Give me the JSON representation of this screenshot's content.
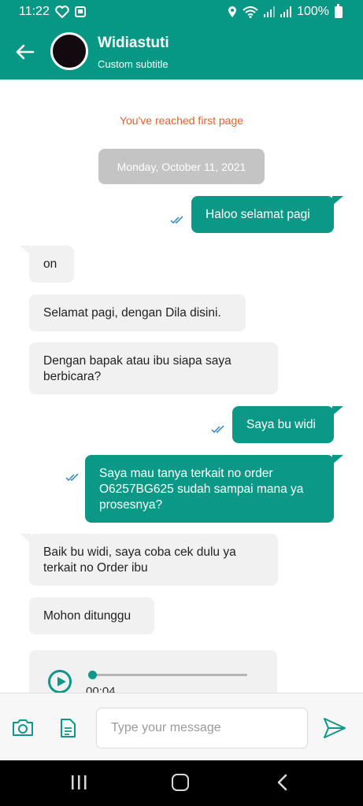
{
  "status_bar": {
    "time": "11:22",
    "battery": "100%"
  },
  "header": {
    "title": "Widiastuti",
    "subtitle": "Custom subtitle"
  },
  "chat": {
    "notice": "You've reached first page",
    "date": "Monday, October 11, 2021",
    "messages": [
      {
        "direction": "out",
        "text": "Haloo selamat pagi"
      },
      {
        "direction": "in",
        "text": "on"
      },
      {
        "direction": "in",
        "text": "Selamat pagi, dengan Dila disini."
      },
      {
        "direction": "in",
        "text": "Dengan bapak atau ibu siapa saya berbicara?"
      },
      {
        "direction": "out",
        "text": "Saya bu widi"
      },
      {
        "direction": "out",
        "text": "Saya mau tanya terkait no order O6257BG625 sudah sampai mana ya prosesnya?"
      },
      {
        "direction": "in",
        "text": "Baik bu widi, saya coba cek dulu ya terkait no Order ibu"
      },
      {
        "direction": "in",
        "text": "Mohon ditunggu"
      }
    ],
    "audio": {
      "duration": "00:04",
      "progress": 0.0
    }
  },
  "composer": {
    "placeholder": "Type your message"
  },
  "icons": {
    "back": "arrow-left-icon",
    "camera": "camera-icon",
    "attachment": "document-icon",
    "send": "send-icon",
    "read_receipt": "double-check-icon",
    "play": "play-icon"
  },
  "colors": {
    "brand": "#079885",
    "outgoing_bubble": "#0b9886",
    "incoming_bubble": "#f1f1f1",
    "notice_text": "#e5622b",
    "date_chip": "#c4c4c4"
  }
}
